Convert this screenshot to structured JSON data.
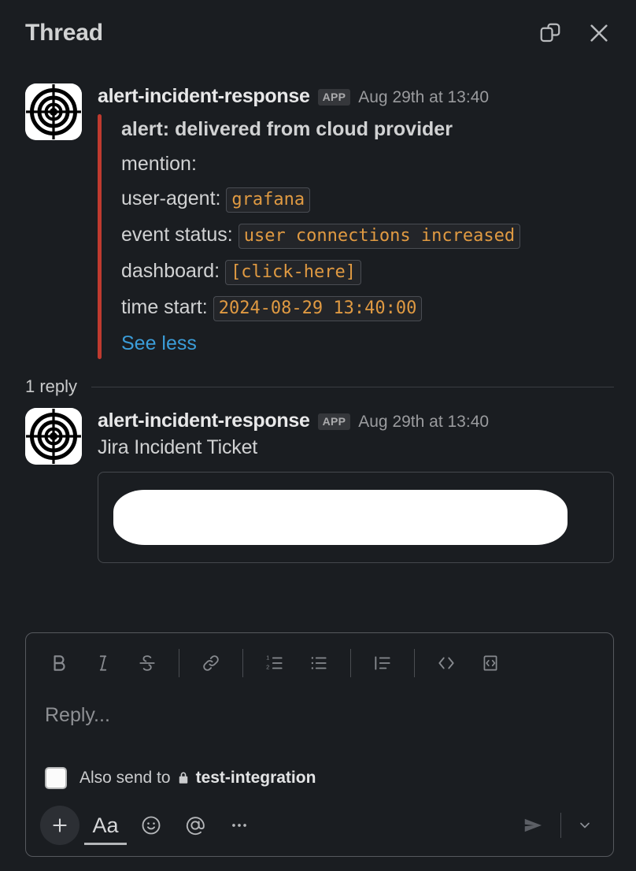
{
  "header": {
    "title": "Thread",
    "open_split_icon": "open-in-split-view-icon",
    "close_icon": "close-icon"
  },
  "root_message": {
    "author": "alert-incident-response",
    "app_badge": "APP",
    "timestamp": "Aug 29th at 13:40",
    "avatar_icon": "target-bullseye-avatar",
    "accent_color": "#bf3a2f",
    "attachment_lines": [
      {
        "label": "alert: delivered from cloud provider",
        "bold": true,
        "code": ""
      },
      {
        "label": "mention:",
        "bold": false,
        "code": ""
      },
      {
        "label": "user-agent:",
        "bold": false,
        "code": "grafana"
      },
      {
        "label": "event status:",
        "bold": false,
        "code": "user connections increased"
      },
      {
        "label": "dashboard:",
        "bold": false,
        "code": "[click-here]"
      },
      {
        "label": "time start:",
        "bold": false,
        "code": "2024-08-29 13:40:00"
      }
    ],
    "see_less": "See less"
  },
  "replies": {
    "count_label": "1 reply",
    "items": [
      {
        "author": "alert-incident-response",
        "app_badge": "APP",
        "timestamp": "Aug 29th at 13:40",
        "text": "Jira Incident Ticket",
        "attachment_redacted": true
      }
    ]
  },
  "composer": {
    "placeholder": "Reply...",
    "format_buttons": [
      "bold-icon",
      "italic-icon",
      "strikethrough-icon",
      "link-icon",
      "ordered-list-icon",
      "bulleted-list-icon",
      "blockquote-icon",
      "code-icon",
      "code-block-icon"
    ],
    "also_send_prefix": "Also send to",
    "also_send_channel": "test-integration",
    "also_send_checked": false,
    "lock_icon": "lock-icon",
    "footer_buttons": [
      "plus-icon",
      "formatting-aa-icon",
      "emoji-icon",
      "mention-icon",
      "more-options-icon"
    ],
    "aa_label": "Aa",
    "more_label": "•••",
    "send_icon": "send-icon",
    "send_options_icon": "chevron-down-icon"
  }
}
